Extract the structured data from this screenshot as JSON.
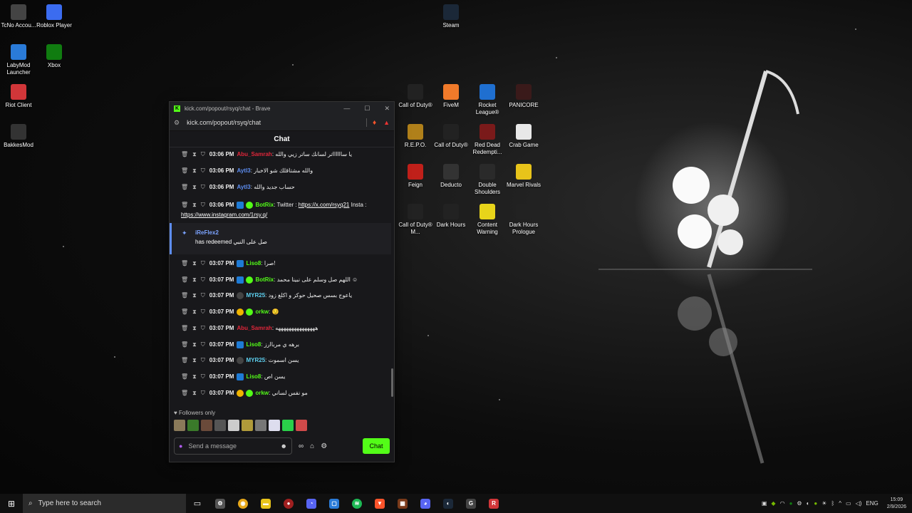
{
  "desktop_icons": [
    {
      "label": "TcNo Accou...",
      "icon": "tcno-icon",
      "color": "#444"
    },
    {
      "label": "Roblox Player",
      "icon": "roblox-icon",
      "color": "#3b6cf0"
    },
    {
      "label": "LabyMod Launcher",
      "icon": "labymod-icon",
      "color": "#2a7bd8"
    },
    {
      "label": "Xbox",
      "icon": "xbox-icon",
      "color": "#107c10"
    },
    {
      "label": "Riot Client",
      "icon": "riot-icon",
      "color": "#d13639"
    },
    {
      "label": "BakkesMod",
      "icon": "bakkesmod-icon",
      "color": "#333"
    },
    {
      "label": "Steam",
      "icon": "steam-icon",
      "color": "#1b2838"
    },
    {
      "label": "Call of Duty®",
      "icon": "cod-icon",
      "color": "#222"
    },
    {
      "label": "FiveM",
      "icon": "fivem-icon",
      "color": "#f07a2a"
    },
    {
      "label": "Rocket League®",
      "icon": "rocket-league-icon",
      "color": "#1f6fd0"
    },
    {
      "label": "PANICORE",
      "icon": "panicore-icon",
      "color": "#3a1a1a"
    },
    {
      "label": "R.E.P.O.",
      "icon": "repo-icon",
      "color": "#b0801a"
    },
    {
      "label": "Call of Duty®",
      "icon": "cod-icon",
      "color": "#222"
    },
    {
      "label": "Red Dead Redempti...",
      "icon": "rdr-icon",
      "color": "#7a1a1a"
    },
    {
      "label": "Crab Game",
      "icon": "crab-game-icon",
      "color": "#e8e8e8"
    },
    {
      "label": "Feign",
      "icon": "feign-icon",
      "color": "#c0201a"
    },
    {
      "label": "Deducto",
      "icon": "deducto-icon",
      "color": "#333"
    },
    {
      "label": "Double Shoulders",
      "icon": "double-shoulders-icon",
      "color": "#2a2a2a"
    },
    {
      "label": "Marvel Rivals",
      "icon": "marvel-rivals-icon",
      "color": "#e8c41a"
    },
    {
      "label": "Call of Duty® M...",
      "icon": "cod-mw-icon",
      "color": "#222"
    },
    {
      "label": "Dark Hours",
      "icon": "dark-hours-icon",
      "color": "#222"
    },
    {
      "label": "Content Warning",
      "icon": "content-warning-icon",
      "color": "#e8d41a"
    },
    {
      "label": "Dark Hours Prologue",
      "icon": "dark-hours-prologue-icon",
      "color": "#222"
    }
  ],
  "window": {
    "title": "kick.com/popout/rsyq/chat - Brave",
    "url": "kick.com/popout/rsyq/chat",
    "chat_heading": "Chat"
  },
  "messages": [
    {
      "time": "03:06 PM",
      "user": "Abu_Samrah",
      "color": "#e0263a",
      "text": ": يا سااااااتر لسانك ساتر زيي والله"
    },
    {
      "time": "03:06 PM",
      "user": "Aytl3",
      "color": "#5d8df0",
      "text": ": والله مشتاقلك شو الاخبار"
    },
    {
      "time": "03:06 PM",
      "user": "Aytl3",
      "color": "#5d8df0",
      "text": ": حساب جديد والله"
    },
    {
      "time": "03:06 PM",
      "user": "BotRix",
      "color": "#53fc18",
      "text": ": Twitter : ",
      "link1": "https://x.com/rsyq21",
      "text2": " Insta : ",
      "link2": "https://www.instagram.com/1rsy.q/"
    },
    {
      "time": "03:07 PM",
      "user": "Liso8",
      "color": "#53fc18",
      "text": ": صرا!"
    },
    {
      "time": "03:07 PM",
      "user": "BotRix",
      "color": "#53fc18",
      "text": ": اللهم صل وسلم على نبينا محمد ☺"
    },
    {
      "time": "03:07 PM",
      "user": "MYR25",
      "color": "#5dd0f0",
      "text": ": ياعوج بسس صحيل حوكز و اكلغ زود"
    },
    {
      "time": "03:07 PM",
      "user": "orkw",
      "color": "#53fc18",
      "text": ":"
    },
    {
      "time": "03:07 PM",
      "user": "Abu_Samrah",
      "color": "#e0263a",
      "text": ": هههههههههههههههه"
    },
    {
      "time": "03:07 PM",
      "user": "Liso8",
      "color": "#53fc18",
      "text": ": برهه ي مرباارز"
    },
    {
      "time": "03:07 PM",
      "user": "MYR25",
      "color": "#5dd0f0",
      "text": ": يسن اسموت"
    },
    {
      "time": "03:07 PM",
      "user": "Liso8",
      "color": "#53fc18",
      "text": ": يسن اص"
    },
    {
      "time": "03:07 PM",
      "user": "orkw",
      "color": "#53fc18",
      "text": ": مو نفس لساني"
    }
  ],
  "redeem": {
    "user": "iReFlex2",
    "text": "has redeemed صل على النبي"
  },
  "followers_only": "Followers only",
  "input": {
    "placeholder": "Send a message"
  },
  "chat_button": "Chat",
  "taskbar": {
    "search_placeholder": "Type here to search",
    "language": "ENG",
    "time": "15:09",
    "date": "2/9/2026"
  }
}
